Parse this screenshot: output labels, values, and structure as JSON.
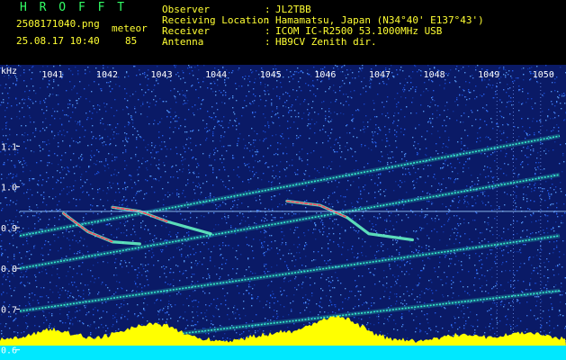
{
  "header": {
    "app_title": "H R O F F T",
    "filename": "2508171040.png",
    "timestamp": "25.08.17 10:40",
    "mode_label": "meteor",
    "count": "85",
    "info_labels": [
      "Observer",
      "Receiving Location",
      "Receiver",
      "Antenna"
    ],
    "info_values": [
      "JL2TBB",
      "Hamamatsu, Japan (N34°40' E137°43')",
      "ICOM IC-R2500 53.1000MHz USB",
      "HB9CV Zenith dir."
    ]
  },
  "chart_data": {
    "type": "heatmap",
    "ylabel": "kHz",
    "ylim": [
      0.575,
      1.26
    ],
    "xlim": [
      1040.4,
      1050.3
    ],
    "x_ticks": [
      "1041",
      "1042",
      "1043",
      "1044",
      "1045",
      "1046",
      "1047",
      "1048",
      "1049",
      "1050"
    ],
    "y_ticks": [
      "1.1",
      "1.0",
      "0.9",
      "0.8",
      "0.7",
      "0.6"
    ],
    "reference_lines_khz": [
      0.94,
      0.617
    ],
    "drifting_carriers": [
      {
        "points": [
          [
            1040.4,
            0.595
          ],
          [
            1050.3,
            0.745
          ]
        ]
      },
      {
        "points": [
          [
            1040.4,
            0.695
          ],
          [
            1050.3,
            0.88
          ]
        ]
      },
      {
        "points": [
          [
            1040.4,
            0.8
          ],
          [
            1050.3,
            1.03
          ]
        ]
      },
      {
        "points": [
          [
            1040.4,
            0.88
          ],
          [
            1050.3,
            1.125
          ]
        ]
      }
    ],
    "meteor_echoes": [
      {
        "points": [
          [
            1041.2,
            0.935
          ],
          [
            1041.65,
            0.89
          ],
          [
            1042.1,
            0.865
          ],
          [
            1042.6,
            0.86
          ]
        ]
      },
      {
        "points": [
          [
            1042.1,
            0.95
          ],
          [
            1042.6,
            0.94
          ],
          [
            1043.1,
            0.915
          ],
          [
            1043.9,
            0.885
          ]
        ]
      },
      {
        "points": [
          [
            1045.3,
            0.965
          ],
          [
            1045.9,
            0.955
          ],
          [
            1046.4,
            0.925
          ],
          [
            1046.8,
            0.885
          ],
          [
            1047.6,
            0.87
          ]
        ]
      }
    ],
    "colors": {
      "background": "#0a1a66",
      "noise": "#2a6aff",
      "reference_line": "#9fd0ff",
      "carrier": "#3cffd0",
      "echo_core": "#ff3a5a",
      "echo_edge": "#6affc8",
      "histogram_top": "#ffff00",
      "histogram_bottom": "#00e8ff",
      "tick_text": "#ffffff",
      "grid_dash": "#7aa0ff"
    }
  }
}
